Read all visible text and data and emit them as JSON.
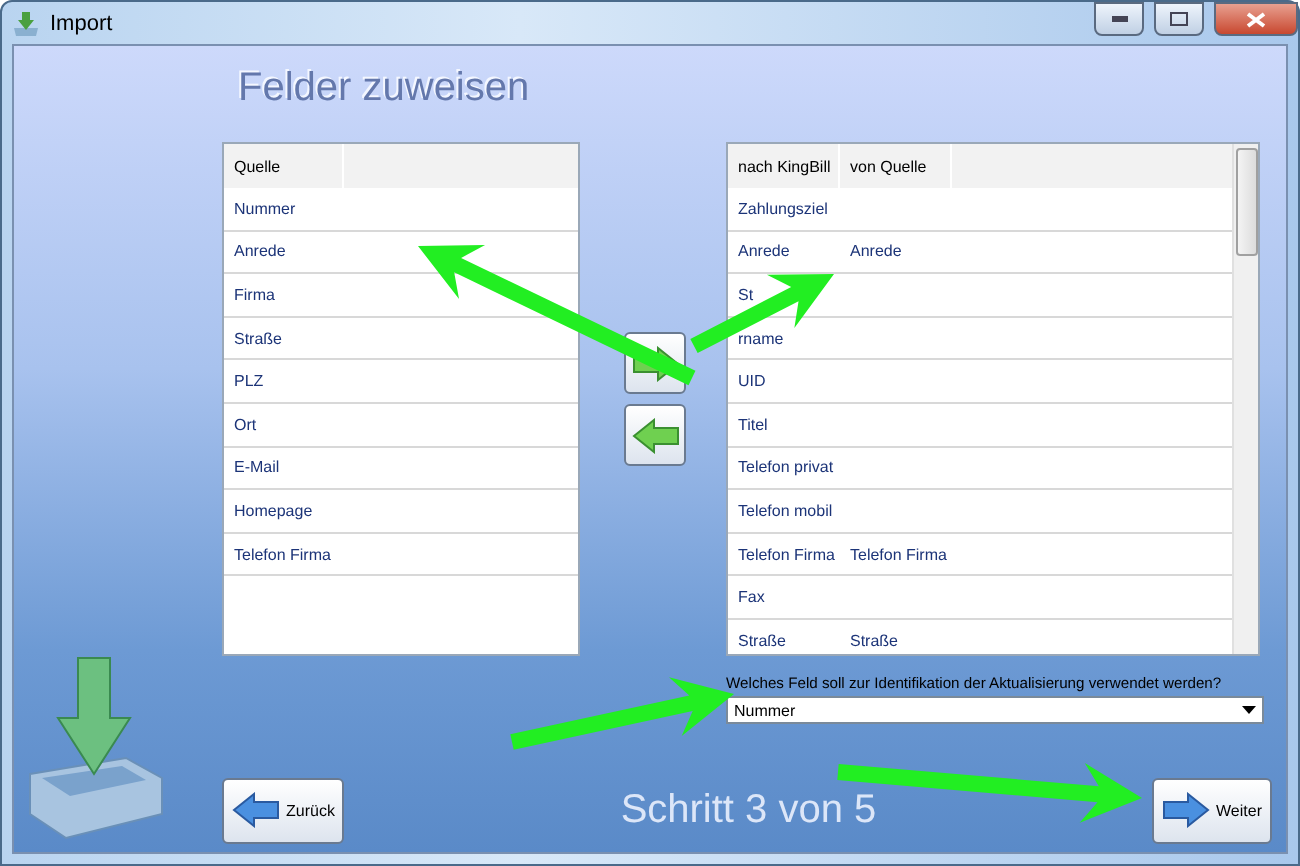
{
  "window": {
    "title": "Import"
  },
  "heading": "Felder zuweisen",
  "source_list": {
    "column": "Quelle",
    "items": [
      "Nummer",
      "Anrede",
      "Firma",
      "Straße",
      "PLZ",
      "Ort",
      "E-Mail",
      "Homepage",
      "Telefon Firma"
    ]
  },
  "target_list": {
    "columns": [
      "nach KingBill",
      "von Quelle"
    ],
    "rows": [
      {
        "target": "Zahlungsziel",
        "source": ""
      },
      {
        "target": "Anrede",
        "source": "Anrede"
      },
      {
        "target": "St",
        "source": ""
      },
      {
        "target": "rname",
        "source": ""
      },
      {
        "target": "UID",
        "source": ""
      },
      {
        "target": "Titel",
        "source": ""
      },
      {
        "target": "Telefon privat",
        "source": ""
      },
      {
        "target": "Telefon mobil",
        "source": ""
      },
      {
        "target": "Telefon Firma",
        "source": "Telefon Firma"
      },
      {
        "target": "Fax",
        "source": ""
      },
      {
        "target": "Straße",
        "source": "Straße"
      }
    ]
  },
  "identification": {
    "label": "Welches Feld soll zur Identifikation der Aktualisierung verwendet werden?",
    "value": "Nummer"
  },
  "back_button": "Zurück",
  "next_button": "Weiter",
  "step": "Schritt 3 von 5"
}
